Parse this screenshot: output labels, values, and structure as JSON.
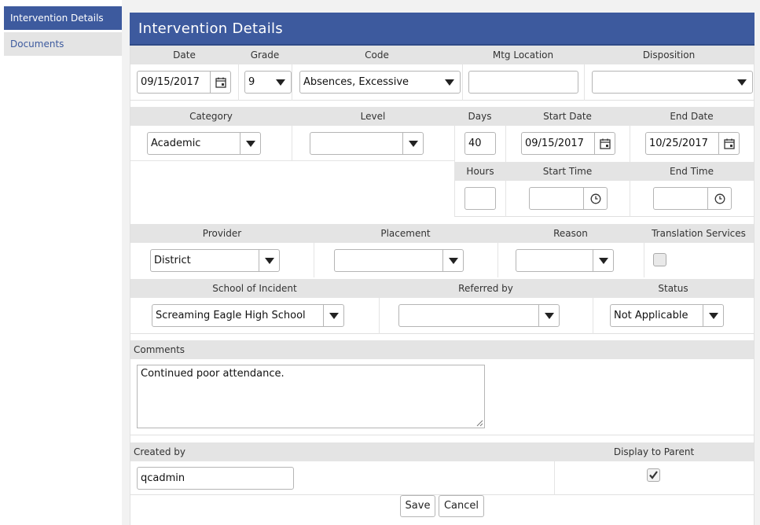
{
  "sidebar": {
    "items": [
      {
        "label": "Intervention Details"
      },
      {
        "label": "Documents"
      }
    ]
  },
  "header": {
    "title": "Intervention Details"
  },
  "section1": {
    "date_label": "Date",
    "grade_label": "Grade",
    "code_label": "Code",
    "mtg_location_label": "Mtg Location",
    "disposition_label": "Disposition",
    "date_value": "09/15/2017",
    "grade_value": "9",
    "code_value": "Absences, Excessive",
    "mtg_location_value": "",
    "disposition_value": ""
  },
  "section2": {
    "category_label": "Category",
    "level_label": "Level",
    "days_label": "Days",
    "start_date_label": "Start Date",
    "end_date_label": "End Date",
    "category_value": "Academic",
    "level_value": "",
    "days_value": "40",
    "start_date_value": "09/15/2017",
    "end_date_value": "10/25/2017",
    "hours_label": "Hours",
    "start_time_label": "Start Time",
    "end_time_label": "End Time",
    "hours_value": "",
    "start_time_value": "",
    "end_time_value": ""
  },
  "section3": {
    "provider_label": "Provider",
    "placement_label": "Placement",
    "reason_label": "Reason",
    "translation_label": "Translation Services",
    "provider_value": "District",
    "placement_value": "",
    "reason_value": "",
    "translation_checked": false,
    "school_label": "School of Incident",
    "referred_label": "Referred by",
    "status_label": "Status",
    "school_value": "Screaming Eagle High School",
    "referred_value": "",
    "status_value": "Not Applicable"
  },
  "comments": {
    "label": "Comments",
    "value": "Continued poor attendance."
  },
  "footer": {
    "created_by_label": "Created by",
    "created_by_value": "qcadmin",
    "display_parent_label": "Display to Parent",
    "display_parent_checked": true
  },
  "actions": {
    "save_label": "Save",
    "cancel_label": "Cancel"
  },
  "colors": {
    "accent": "#3d5a9e",
    "header_bg": "#e4e4e4",
    "page_bg": "#f2f2f2"
  }
}
